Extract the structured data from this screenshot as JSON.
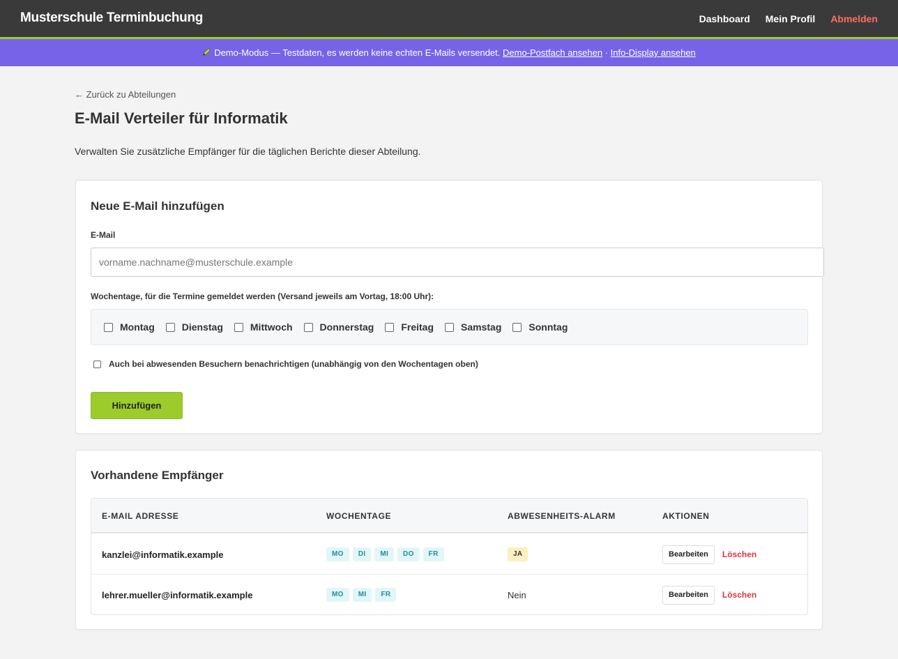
{
  "header": {
    "brand": "Musterschule Terminbuchung",
    "nav": {
      "dashboard": "Dashboard",
      "profile": "Mein Profil",
      "logout": "Abmelden"
    }
  },
  "demo_bar": {
    "icon": "pencil-icon",
    "text": "Demo-Modus — Testdaten, es werden keine echten E-Mails versendet. ",
    "inbox_link": "Demo-Postfach ansehen",
    "separator": " · ",
    "display_link": "Info-Display ansehen"
  },
  "back_link": "← Zurück zu Abteilungen",
  "page_title": "E-Mail Verteiler für Informatik",
  "subtitle": "Verwalten Sie zusätzliche Empfänger für die täglichen Berichte dieser Abteilung.",
  "add_form": {
    "title": "Neue E-Mail hinzufügen",
    "email_label": "E-Mail",
    "email_value": "",
    "email_placeholder": "vorname.nachname@musterschule.example",
    "days_label": "Wochentage, für die Termine gemeldet werden (Versand jeweils am Vortag, 18:00 Uhr):",
    "days": [
      "Montag",
      "Dienstag",
      "Mittwoch",
      "Donnerstag",
      "Freitag",
      "Samstag",
      "Sonntag"
    ],
    "absent_label": "Auch bei abwesenden Besuchern benachrichtigen (unabhängig von den Wochentagen oben)",
    "submit": "Hinzufügen"
  },
  "recipients": {
    "title": "Vorhandene Empfänger",
    "columns": [
      "E-MAIL ADRESSE",
      "WOCHENTAGE",
      "ABWESENHEITS-ALARM",
      "AKTIONEN"
    ],
    "rows": [
      {
        "email": "kanzlei@informatik.example",
        "days": [
          "MO",
          "DI",
          "MI",
          "DO",
          "FR"
        ],
        "alarm": "JA",
        "edit": "Bearbeiten",
        "delete": "Löschen"
      },
      {
        "email": "lehrer.mueller@informatik.example",
        "days": [
          "MO",
          "MI",
          "FR"
        ],
        "alarm": "Nein",
        "edit": "Bearbeiten",
        "delete": "Löschen"
      }
    ]
  },
  "colors": {
    "accent_green": "#9ccc2b",
    "demo_purple": "#7763e8",
    "logout_red": "#ff6f61",
    "delete_red": "#d9363e"
  }
}
